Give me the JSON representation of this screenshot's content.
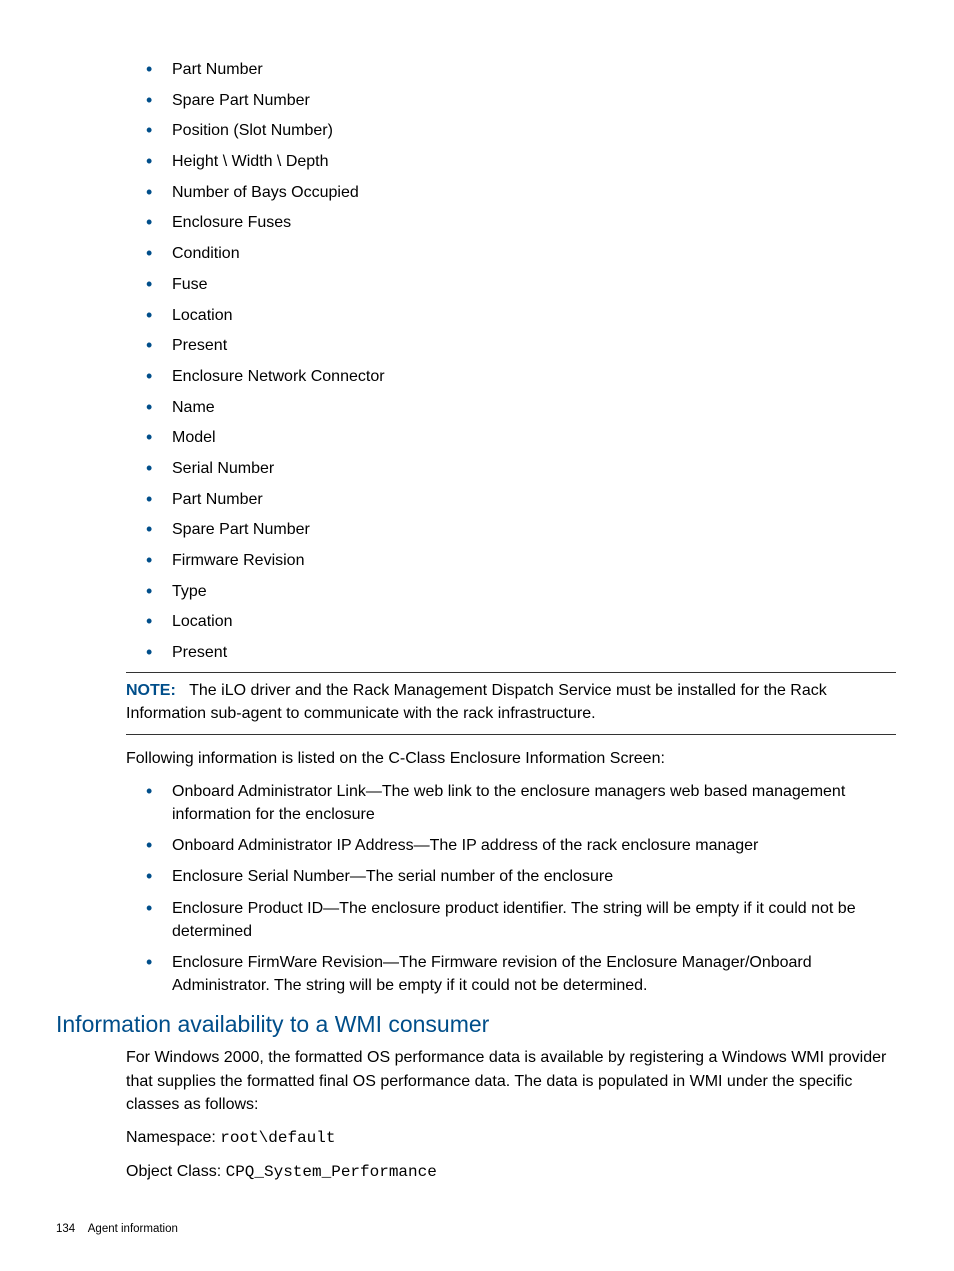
{
  "list1": [
    "Part Number",
    "Spare Part Number",
    "Position (Slot Number)",
    "Height \\ Width \\ Depth",
    "Number of Bays Occupied",
    "Enclosure Fuses",
    "Condition",
    "Fuse",
    "Location",
    "Present",
    "Enclosure Network Connector",
    "Name",
    "Model",
    "Serial Number",
    "Part Number",
    "Spare Part Number",
    "Firmware Revision",
    "Type",
    "Location",
    "Present"
  ],
  "note": {
    "label": "NOTE:",
    "text": "The iLO driver and the Rack Management Dispatch Service must be installed for the Rack Information sub-agent to communicate with the rack infrastructure."
  },
  "para_following": "Following information is listed on the C-Class Enclosure Information Screen:",
  "list2": [
    "Onboard Administrator Link—The web link to the enclosure managers web based management information for the enclosure",
    "Onboard Administrator IP Address—The IP address of the rack enclosure manager",
    "Enclosure Serial Number—The serial number of the enclosure",
    "Enclosure Product ID—The enclosure product identifier. The string will be empty if it could not be determined",
    "Enclosure FirmWare Revision—The Firmware revision of the Enclosure Manager/Onboard Administrator. The string will be empty if it could not be determined."
  ],
  "heading": "Information availability to a WMI consumer",
  "para_wmi": "For Windows 2000, the formatted OS performance data is available by registering a Windows WMI provider that supplies the formatted final OS performance data. The data is populated in WMI under the specific classes as follows:",
  "ns_label": "Namespace: ",
  "ns_value": "root\\default",
  "oc_label": "Object Class: ",
  "oc_value": "CPQ_System_Performance",
  "footer": {
    "page": "134",
    "title": "Agent information"
  }
}
